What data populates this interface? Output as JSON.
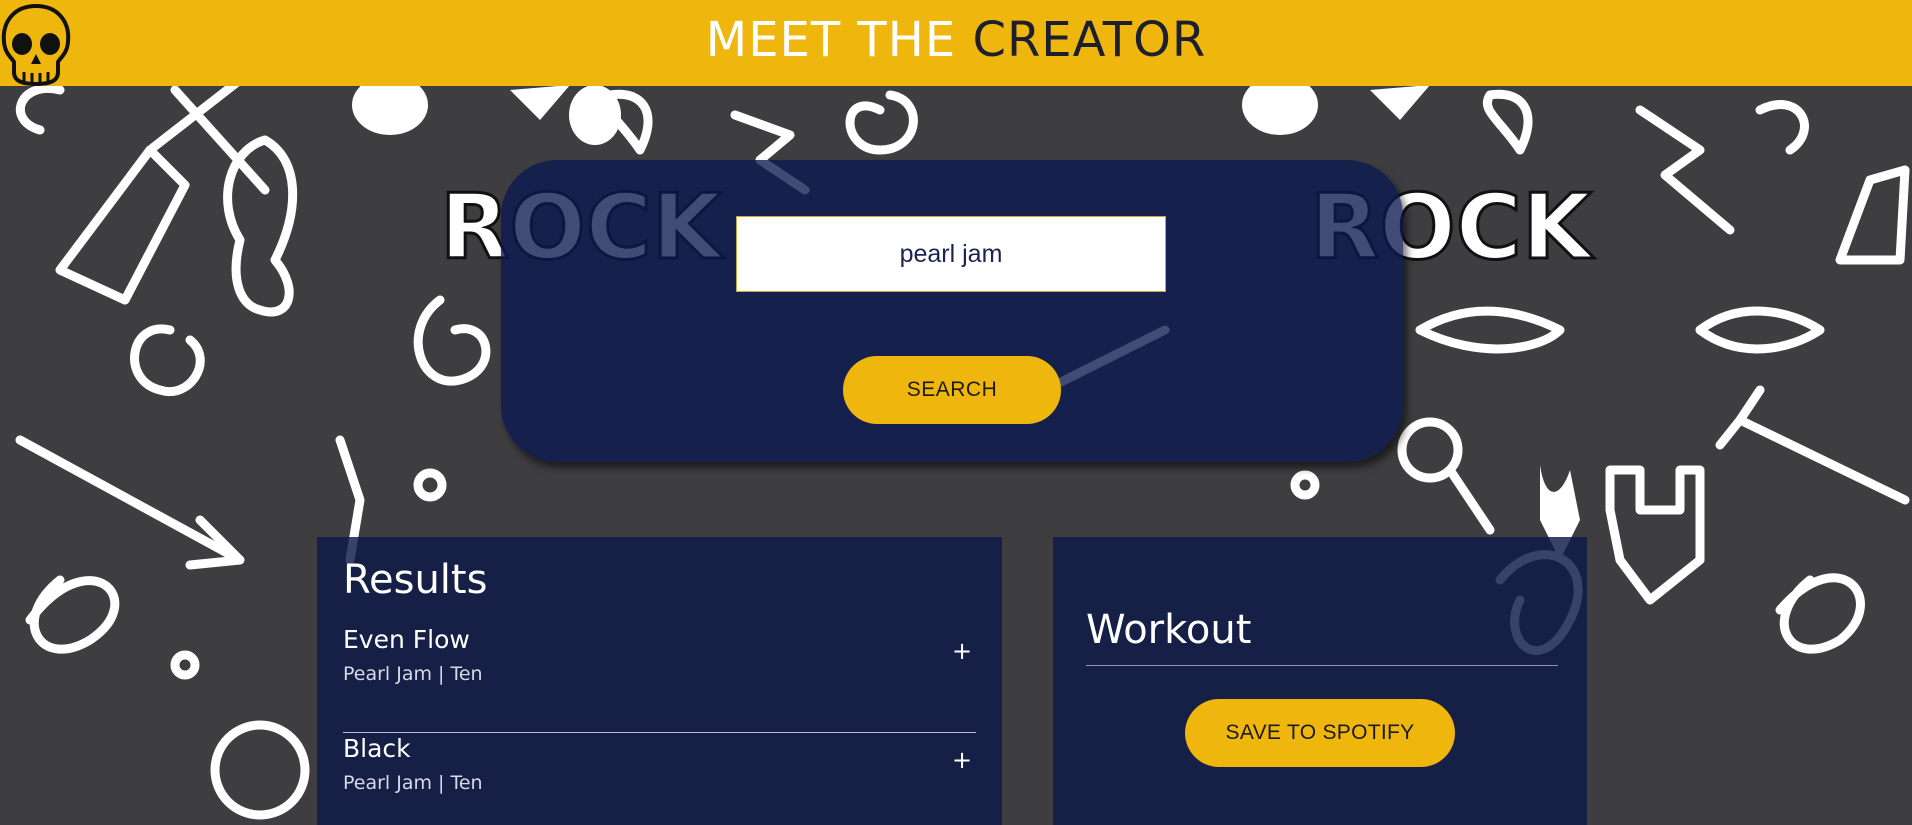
{
  "header": {
    "title_part1": "MEET THE",
    "title_part2": "CREATOR",
    "logo_icon": "skull-icon"
  },
  "search": {
    "value": "pearl jam",
    "button_label": "SEARCH"
  },
  "results": {
    "heading": "Results",
    "tracks": [
      {
        "name": "Even Flow",
        "meta": "Pearl Jam | Ten",
        "add_label": "+"
      },
      {
        "name": "Black",
        "meta": "Pearl Jam | Ten",
        "add_label": "+"
      }
    ]
  },
  "workout": {
    "heading": "Workout",
    "save_label": "SAVE TO SPOTIFY"
  },
  "colors": {
    "accent": "#efb60d",
    "panel": "#0e1848",
    "background": "#3e3e40"
  }
}
